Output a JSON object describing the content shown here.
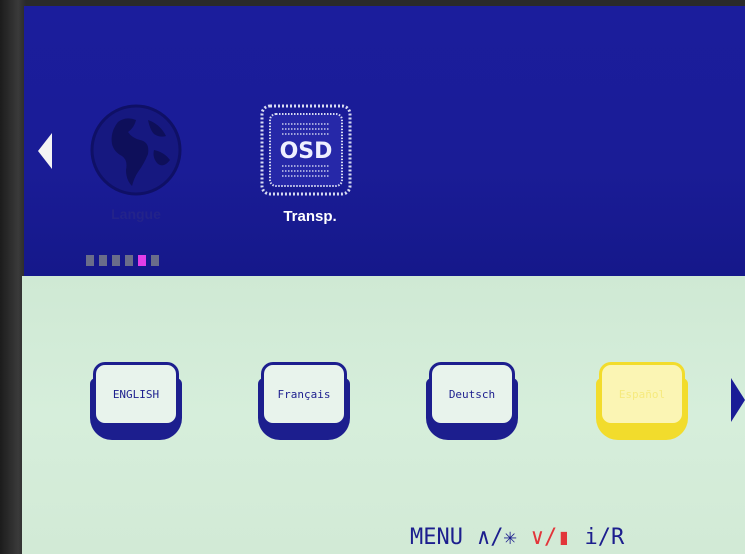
{
  "osd": {
    "menu_items": [
      {
        "label": "Langue",
        "icon": "globe-icon"
      },
      {
        "label": "Transp.",
        "icon": "osd-transparency-icon",
        "icon_text": "OSD"
      }
    ],
    "page_indicator": {
      "total": 6,
      "active": 5
    },
    "languages": [
      {
        "label": "ENGLISH"
      },
      {
        "label": "Français"
      },
      {
        "label": "Deutsch"
      },
      {
        "label": "Español",
        "selected": true
      }
    ],
    "footer": {
      "menu": "MENU",
      "up": "∧/✳",
      "down": "∨/▮",
      "info": "i/R"
    },
    "colors": {
      "top_panel": "#1a1c96",
      "bottom_panel": "#d2ead6",
      "selected": "#f2dc2c",
      "indicator_active": "#e23ee8",
      "footer_red": "#e2353a"
    }
  }
}
